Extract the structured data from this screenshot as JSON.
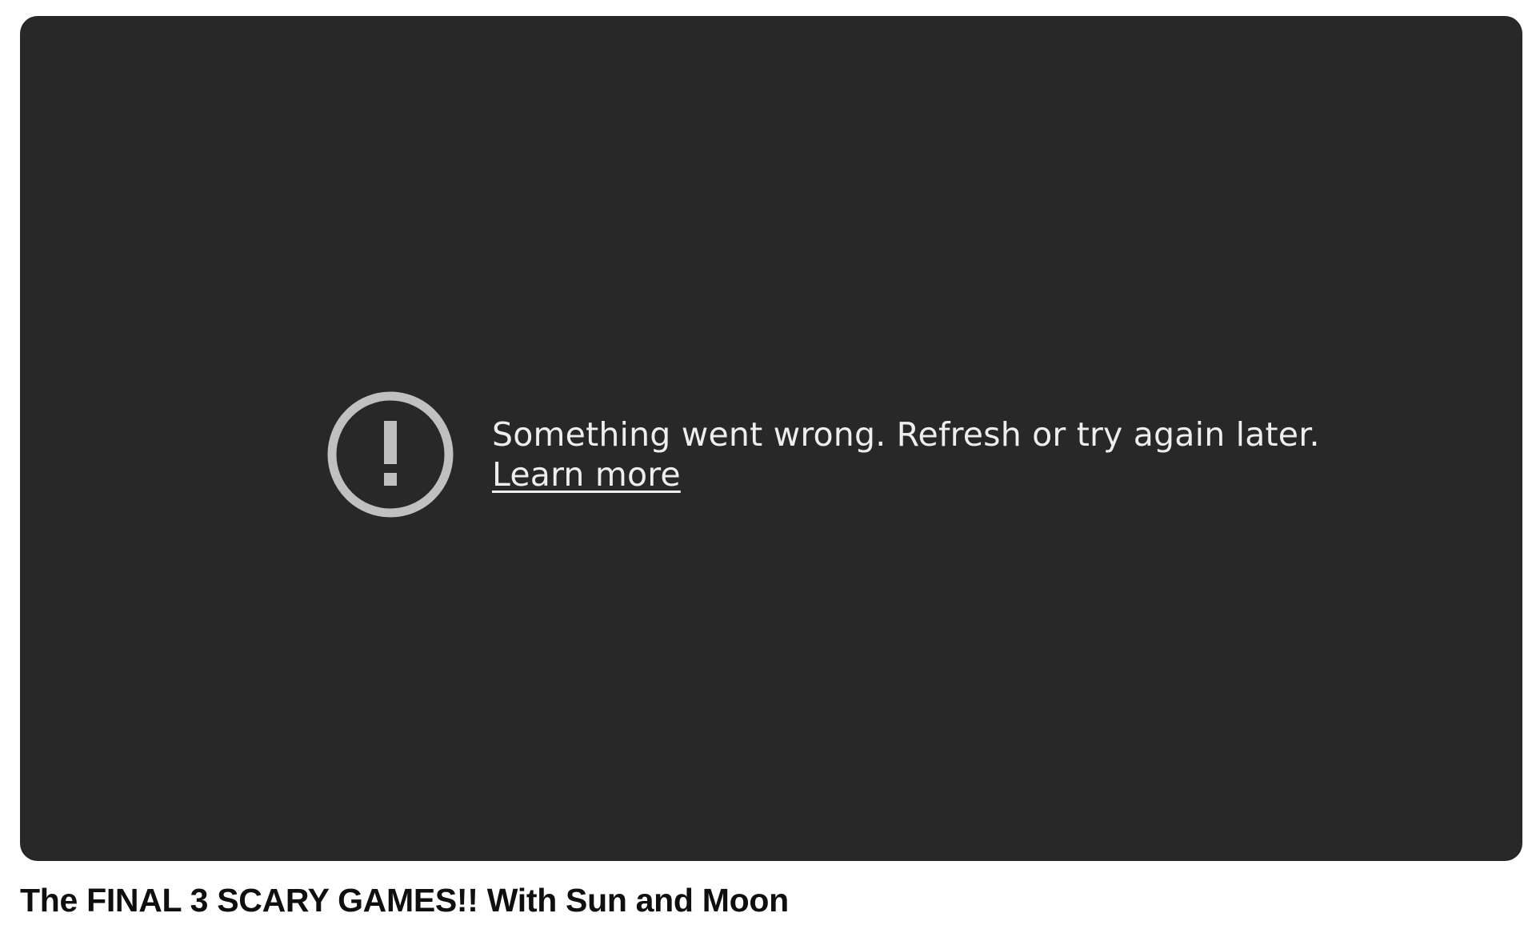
{
  "player": {
    "background_color": "#282828",
    "error": {
      "icon": "alert-circle-icon",
      "icon_color": "#c0c0c0",
      "message": "Something went wrong. Refresh or try again later.",
      "learn_more_label": "Learn more",
      "text_color": "#eeeeee"
    }
  },
  "video": {
    "title": "The FINAL 3 SCARY GAMES!! With Sun and Moon"
  }
}
